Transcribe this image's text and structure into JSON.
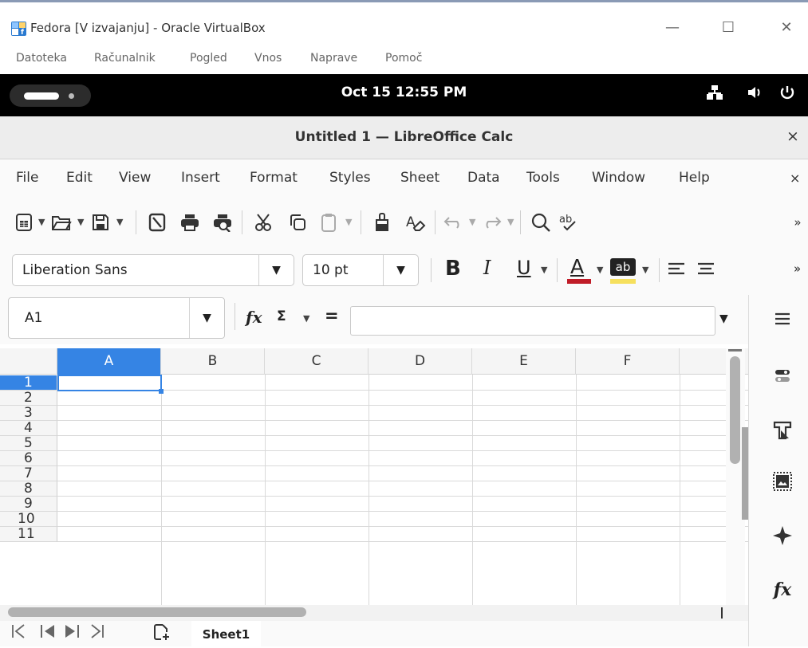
{
  "vbox": {
    "title": "Fedora [V izvajanju] - Oracle VirtualBox",
    "minimize": "—",
    "maximize": "☐",
    "close": "✕",
    "menu": [
      "Datoteka",
      "Računalnik",
      "Pogled",
      "Vnos",
      "Naprave",
      "Pomoč"
    ]
  },
  "gnome": {
    "clock": "Oct 15  12:55 PM",
    "tray": {
      "network": "network-icon",
      "volume": "volume-icon",
      "power": "power-icon"
    }
  },
  "lo": {
    "title": "Untitled 1 — LibreOffice Calc",
    "close": "×",
    "menu": [
      "File",
      "Edit",
      "View",
      "Insert",
      "Format",
      "Styles",
      "Sheet",
      "Data",
      "Tools",
      "Window",
      "Help"
    ],
    "menu_close": "×",
    "font_name": "Liberation Sans",
    "font_size": "10 pt",
    "name_box": "A1",
    "formula_value": "",
    "formula_fx": "fx",
    "formula_sum": "Σ",
    "formula_equals": "=",
    "columns": [
      "A",
      "B",
      "C",
      "D",
      "E",
      "F"
    ],
    "rows": [
      "1",
      "2",
      "3",
      "4",
      "5",
      "6",
      "7",
      "8",
      "9",
      "10",
      "11"
    ],
    "active_cell": "A1",
    "sheet_tab": "Sheet1",
    "accent_color": "#3584e4",
    "font_color_bar": "#c01c28",
    "highlight_color_bar": "#f6e05e"
  }
}
